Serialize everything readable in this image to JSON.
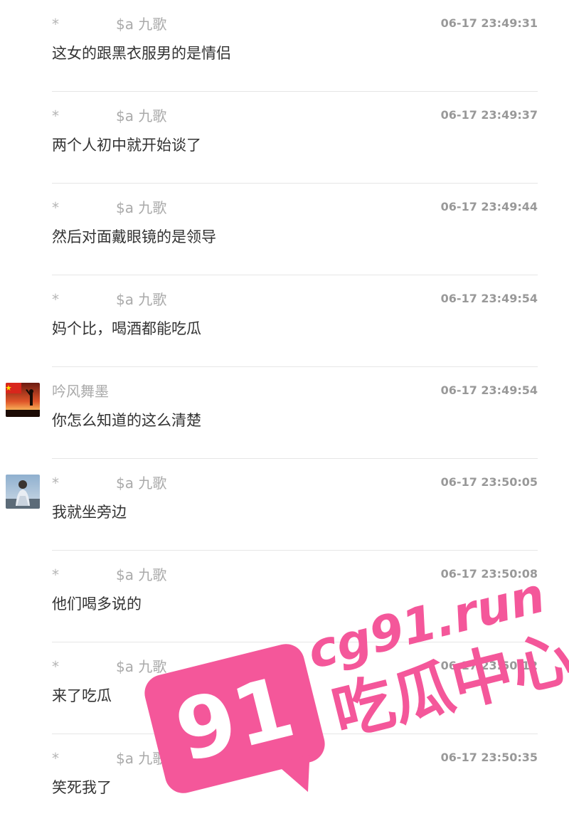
{
  "messages": [
    {
      "star": "*",
      "name": "$a 九歌",
      "time": "06-17 23:49:31",
      "text": "这女的跟黑衣服男的是情侣",
      "avatar": ""
    },
    {
      "star": "*",
      "name": "$a 九歌",
      "time": "06-17 23:49:37",
      "text": "两个人初中就开始谈了",
      "avatar": ""
    },
    {
      "star": "*",
      "name": "$a 九歌",
      "time": "06-17 23:49:44",
      "text": "然后对面戴眼镜的是领导",
      "avatar": ""
    },
    {
      "star": "*",
      "name": "$a 九歌",
      "time": "06-17 23:49:54",
      "text": "妈个比，喝酒都能吃瓜",
      "avatar": ""
    },
    {
      "star": "",
      "name": "吟风舞墨",
      "time": "06-17 23:49:54",
      "text": "你怎么知道的这么清楚",
      "avatar": "flag-sunset"
    },
    {
      "star": "*",
      "name": "$a 九歌",
      "time": "06-17 23:50:05",
      "text": "我就坐旁边",
      "avatar": "person-photo"
    },
    {
      "star": "*",
      "name": "$a 九歌",
      "time": "06-17 23:50:08",
      "text": "他们喝多说的",
      "avatar": ""
    },
    {
      "star": "*",
      "name": "$a 九歌",
      "time": "06-17 23:50:12",
      "text": "来了吃瓜",
      "avatar": ""
    },
    {
      "star": "*",
      "name": "$a 九歌",
      "time": "06-17 23:50:35",
      "text": "笑死我了",
      "avatar": ""
    }
  ],
  "watermark": {
    "badge": "91",
    "domain": "cg91.run",
    "slogan": "吃瓜中心",
    "color": "#f4579a"
  }
}
